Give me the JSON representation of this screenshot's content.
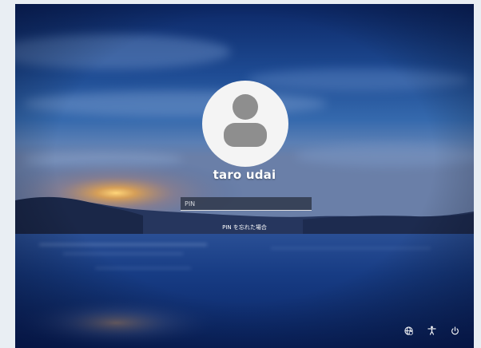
{
  "user": {
    "name": "taro udai"
  },
  "login": {
    "pin_placeholder": "PIN",
    "forgot_pin_link": "PIN を忘れた場合"
  },
  "system_icons": [
    {
      "name": "network-icon"
    },
    {
      "name": "accessibility-icon"
    },
    {
      "name": "power-icon"
    }
  ],
  "colors": {
    "sky_top": "#0c2a6e",
    "sky_mid": "#2f5fa6",
    "horizon_glow": "#e8b35a",
    "water": "#0e2b6b",
    "avatar_bg": "#f4f4f4",
    "avatar_figure": "#8e8e8e",
    "text": "#ffffff"
  }
}
